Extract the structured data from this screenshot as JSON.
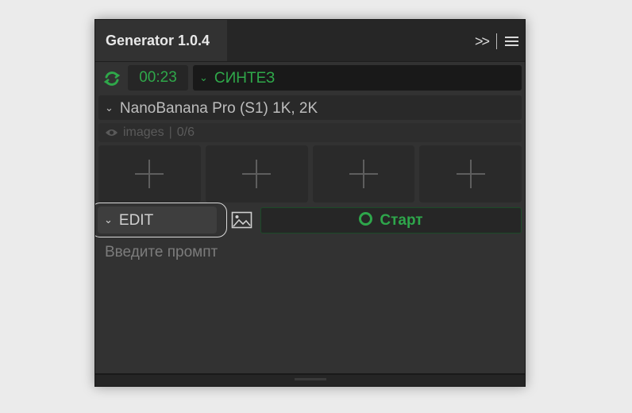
{
  "panel": {
    "title": "Generator 1.0.4",
    "overflow_icon": "double-chevron-right-icon",
    "menu_icon": "hamburger-menu-icon"
  },
  "controls": {
    "timer": "00:23",
    "mode": "СИНТЕЗ",
    "model": "NanoBanana Pro (S1) 1K, 2K",
    "images_label": "images",
    "images_count": "0/6",
    "slots": [
      "add",
      "add",
      "add",
      "add"
    ],
    "edit_mode": "EDIT",
    "start_label": "Старт",
    "prompt_placeholder": "Введите промпт"
  },
  "colors": {
    "accent_green": "#2fa84a",
    "panel_bg": "#323232",
    "page_bg": "#ebebeb"
  }
}
